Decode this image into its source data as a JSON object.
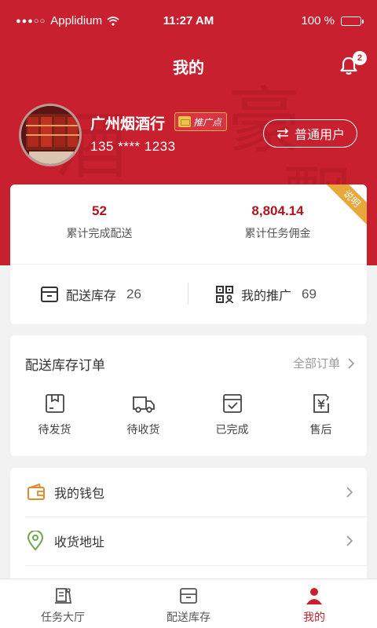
{
  "status_bar": {
    "carrier": "Applidium",
    "time": "11:27 AM",
    "battery": "100 %"
  },
  "header": {
    "title": "我的",
    "notification_count": "2"
  },
  "profile": {
    "shop_name": "广州烟酒行",
    "promo_tag": "推广点",
    "phone": "135 **** 1233",
    "user_type": "普通用户"
  },
  "stats": {
    "ribbon": "说明",
    "delivered": {
      "value": "52",
      "label": "累计完成配送"
    },
    "commission": {
      "value": "8,804.14",
      "label": "累计任务佣金"
    }
  },
  "quick_links": [
    {
      "label": "配送库存",
      "count": "26",
      "icon": "box-icon"
    },
    {
      "label": "我的推广",
      "count": "69",
      "icon": "qr-person-icon"
    }
  ],
  "orders": {
    "title": "配送库存订单",
    "all_label": "全部订单",
    "items": [
      {
        "label": "待发货",
        "icon": "package-icon"
      },
      {
        "label": "待收货",
        "icon": "truck-icon"
      },
      {
        "label": "已完成",
        "icon": "check-box-icon"
      },
      {
        "label": "售后",
        "icon": "yen-refund-icon"
      }
    ]
  },
  "menu": [
    {
      "label": "我的钱包",
      "icon": "wallet-icon"
    },
    {
      "label": "收货地址",
      "icon": "location-icon"
    }
  ],
  "tabbar": [
    {
      "label": "任务大厅",
      "icon": "tasks-icon"
    },
    {
      "label": "配送库存",
      "icon": "inventory-box-icon"
    },
    {
      "label": "我的",
      "icon": "user-icon"
    }
  ],
  "colors": {
    "primary": "#c8202e",
    "ribbon": "#e6a83a",
    "value": "#b0151f"
  }
}
